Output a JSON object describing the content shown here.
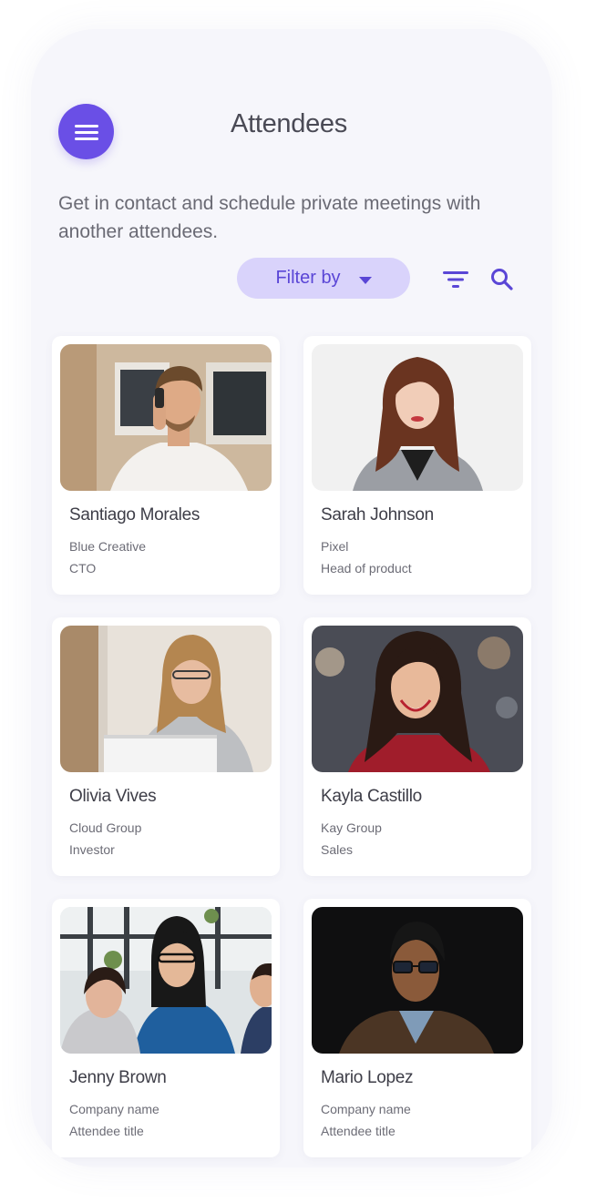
{
  "header": {
    "title": "Attendees",
    "menu_icon": "hamburger-menu-icon"
  },
  "intro": {
    "text": "Get in contact and schedule private meetings with another attendees."
  },
  "toolbar": {
    "filter_label": "Filter by",
    "filter_icon": "filter-lines-icon",
    "search_icon": "search-icon"
  },
  "colors": {
    "accent": "#6a4fe6",
    "filter_bg": "#d9d3fb",
    "background": "#f6f6fb"
  },
  "attendees": [
    {
      "name": "Santiago Morales",
      "company": "Blue Creative",
      "title": "CTO"
    },
    {
      "name": "Sarah Johnson",
      "company": "Pixel",
      "title": "Head of product"
    },
    {
      "name": "Olivia Vives",
      "company": "Cloud Group",
      "title": "Investor"
    },
    {
      "name": "Kayla Castillo",
      "company": "Kay Group",
      "title": "Sales"
    },
    {
      "name": "Jenny Brown",
      "company": "Company name",
      "title": "Attendee title"
    },
    {
      "name": "Mario Lopez",
      "company": "Company name",
      "title": "Attendee title"
    }
  ]
}
